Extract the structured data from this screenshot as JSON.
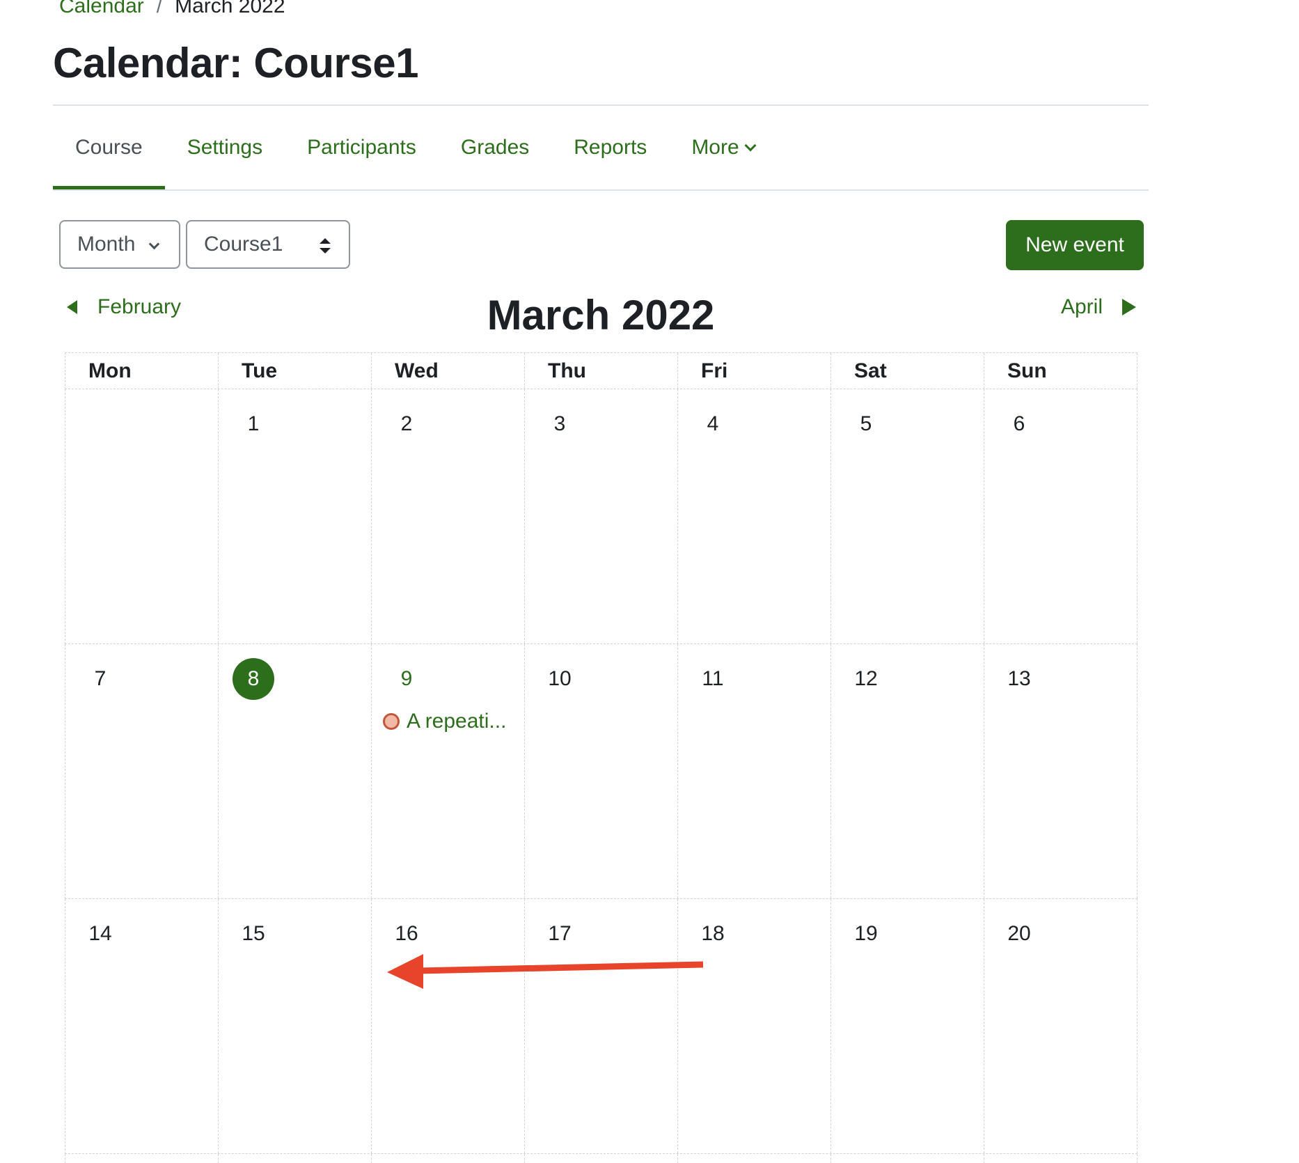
{
  "breadcrumb": {
    "link": "Calendar",
    "separator": "/",
    "current": "March 2022"
  },
  "page_title": "Calendar: Course1",
  "nav": {
    "tabs": [
      {
        "label": "Course",
        "active": true
      },
      {
        "label": "Settings"
      },
      {
        "label": "Participants"
      },
      {
        "label": "Grades"
      },
      {
        "label": "Reports"
      },
      {
        "label": "More"
      }
    ]
  },
  "controls": {
    "view_select": "Month",
    "course_select": "Course1",
    "new_event_label": "New event"
  },
  "month_nav": {
    "prev": "February",
    "title": "March 2022",
    "next": "April"
  },
  "calendar": {
    "days_of_week": [
      "Mon",
      "Tue",
      "Wed",
      "Thu",
      "Fri",
      "Sat",
      "Sun"
    ],
    "weeks": [
      [
        "",
        "1",
        "2",
        "3",
        "4",
        "5",
        "6"
      ],
      [
        "7",
        "8",
        "9",
        "10",
        "11",
        "12",
        "13"
      ],
      [
        "14",
        "15",
        "16",
        "17",
        "18",
        "19",
        "20"
      ]
    ],
    "today": "8",
    "event": {
      "day": "9",
      "label": "A repeati..."
    }
  },
  "colors": {
    "brand": "#2c6e1b",
    "annotation_arrow": "#e8432b",
    "event_dot": "#c0563a"
  },
  "icons": {
    "prev": "triangle-left-icon",
    "next": "triangle-right-icon",
    "more": "chevron-down-icon",
    "view_select": "chevron-down-icon",
    "course_select": "sort-updown-icon",
    "event": "event-course-dot-icon"
  }
}
